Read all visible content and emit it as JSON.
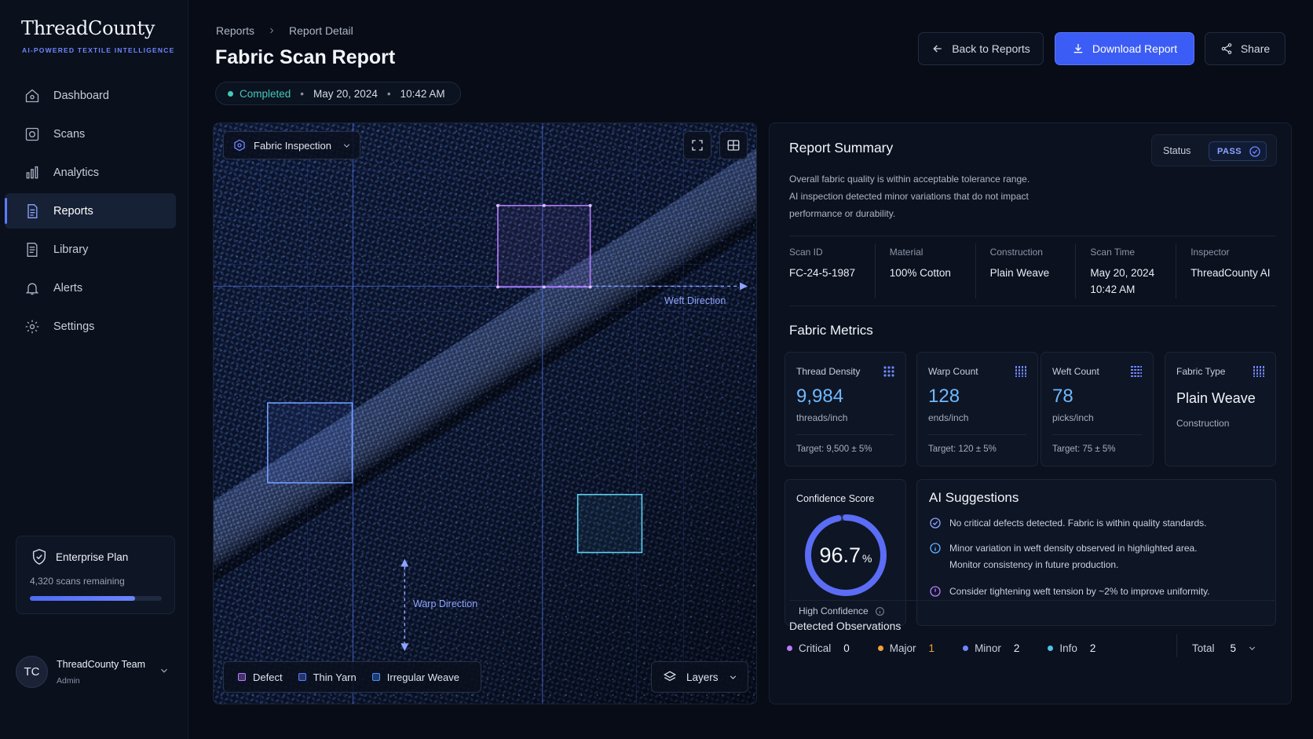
{
  "brand": {
    "name": "ThreadCounty",
    "tagline": "AI-POWERED TEXTILE INTELLIGENCE"
  },
  "nav": [
    {
      "label": "Dashboard",
      "icon": "home-icon"
    },
    {
      "label": "Scans",
      "icon": "scan-icon"
    },
    {
      "label": "Analytics",
      "icon": "bar-chart-icon"
    },
    {
      "label": "Reports",
      "icon": "document-icon",
      "active": true
    },
    {
      "label": "Library",
      "icon": "library-icon"
    },
    {
      "label": "Alerts",
      "icon": "bell-icon"
    },
    {
      "label": "Settings",
      "icon": "gear-icon"
    }
  ],
  "plan": {
    "title": "Enterprise Plan",
    "subtitle": "4,320 scans remaining",
    "usage_fraction": 0.8
  },
  "user": {
    "initials": "TC",
    "name": "ThreadCounty Team",
    "role": "Admin"
  },
  "breadcrumb": {
    "parent": "Reports",
    "current": "Report Detail"
  },
  "page_title": "Fabric Scan Report",
  "status": {
    "state": "Completed",
    "date": "May 20, 2024",
    "time": "10:42 AM",
    "color": "#43c9b8"
  },
  "actions": {
    "back": "Back to Reports",
    "download": "Download Report",
    "share": "Share"
  },
  "scan_view": {
    "mode": "Fabric Inspection",
    "weft_label": "Weft Direction",
    "warp_label": "Warp Direction",
    "legend": [
      {
        "label": "Defect",
        "color": "#b67cff"
      },
      {
        "label": "Thin Yarn",
        "color": "#5b7cff"
      },
      {
        "label": "Irregular Weave",
        "color": "#4a8dff"
      }
    ],
    "layers_label": "Layers"
  },
  "summary": {
    "title": "Report Summary",
    "status_label": "Status",
    "status_value": "PASS",
    "description_lines": [
      "Overall fabric quality is within acceptable tolerance range.",
      "AI inspection detected minor variations that do not impact",
      "performance or durability."
    ],
    "meta": [
      {
        "label": "Scan ID",
        "value": "FC-24-5-1987"
      },
      {
        "label": "Material",
        "value": "100% Cotton"
      },
      {
        "label": "Construction",
        "value": "Plain Weave"
      },
      {
        "label": "Scan Time",
        "value": "May 20, 2024",
        "value2": "10:42 AM"
      },
      {
        "label": "Inspector",
        "value": "ThreadCounty AI"
      }
    ]
  },
  "metrics": {
    "title": "Fabric Metrics",
    "cards": [
      {
        "label": "Thread Density",
        "value": "9,984",
        "unit": "threads/inch",
        "target": "Target: 9,500 ± 5%"
      },
      {
        "label": "Warp Count",
        "value": "128",
        "unit": "ends/inch",
        "target": "Target: 120 ± 5%"
      },
      {
        "label": "Weft Count",
        "value": "78",
        "unit": "picks/inch",
        "target": "Target: 75 ± 5%"
      },
      {
        "label": "Fabric Type",
        "value": "Plain Weave",
        "unit": "Construction",
        "target": ""
      }
    ]
  },
  "confidence": {
    "label": "Confidence Score",
    "value": "96.7",
    "unit": "%",
    "fraction": 0.967,
    "level": "High Confidence"
  },
  "ai": {
    "title": "AI Suggestions",
    "items": [
      {
        "text": "No critical defects detected. Fabric is within quality standards.",
        "icon": "check-circle-icon"
      },
      {
        "text": "Minor variation in weft density observed in highlighted area.",
        "text2": "Monitor consistency in future production.",
        "icon": "info-icon"
      },
      {
        "text": "Consider tightening weft tension by ~2% to improve uniformity.",
        "icon": "alert-icon"
      }
    ]
  },
  "observations": {
    "title": "Detected Observations",
    "items": [
      {
        "label": "Critical",
        "count": "0",
        "color": "#b67cff"
      },
      {
        "label": "Major",
        "count": "1",
        "color": "#f0a03c"
      },
      {
        "label": "Minor",
        "count": "2",
        "color": "#6f86ff"
      },
      {
        "label": "Info",
        "count": "2",
        "color": "#4fc3e8"
      }
    ],
    "total_label": "Total",
    "total": "5"
  }
}
